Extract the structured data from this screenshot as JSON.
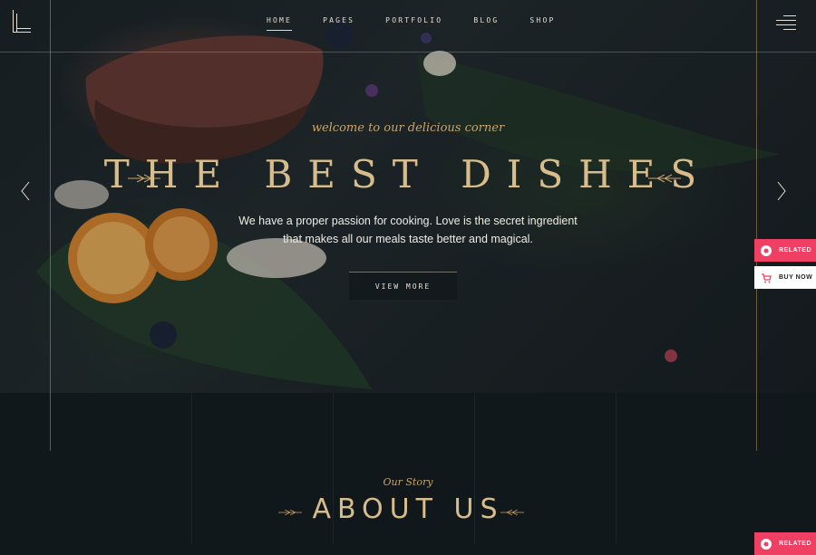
{
  "nav": {
    "items": [
      {
        "label": "HOME",
        "active": true
      },
      {
        "label": "PAGES",
        "active": false
      },
      {
        "label": "PORTFOLIO",
        "active": false
      },
      {
        "label": "BLOG",
        "active": false
      },
      {
        "label": "SHOP",
        "active": false
      }
    ]
  },
  "hero": {
    "tagline": "welcome to our delicious corner",
    "title": "THE BEST DISHES",
    "subtitle_line1": "We have a proper passion for cooking. Love is the secret ingredient",
    "subtitle_line2": "that makes all our meals taste better and magical.",
    "button_label": "VIEW MORE"
  },
  "side_buttons": {
    "related_label": "RELATED",
    "buy_now_label": "BUY NOW",
    "related2_label": "RELATED"
  },
  "about": {
    "kicker": "Our Story",
    "title": "ABOUT US"
  },
  "colors": {
    "accent_gold": "#d8bd8c",
    "related_pink": "#ef3f62",
    "background": "#11181b"
  },
  "icons": [
    "logo-mark",
    "hamburger-menu-icon",
    "arrow-left-icon",
    "arrow-right-icon",
    "related-icon",
    "cart-icon",
    "divider-ornament"
  ]
}
